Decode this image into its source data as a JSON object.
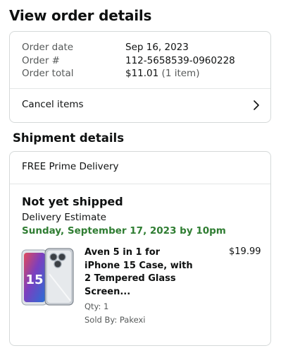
{
  "page": {
    "title": "View order details"
  },
  "order_summary": {
    "date_label": "Order date",
    "date_value": "Sep 16, 2023",
    "number_label": "Order #",
    "number_value": "112-5658539-0960228",
    "total_label": "Order total",
    "total_value": "$11.01",
    "total_items": "(1 item)",
    "cancel_label": "Cancel items"
  },
  "shipment": {
    "section_title": "Shipment details",
    "delivery_type": "FREE Prime Delivery",
    "status": "Not yet shipped",
    "estimate_label": "Delivery Estimate",
    "estimate_date": "Sunday, September 17, 2023 by 10pm",
    "item": {
      "title": "Aven 5 in 1 for iPhone 15 Case, with 2 Tempered Glass Screen...",
      "price": "$19.99",
      "qty": "Qty: 1",
      "seller": "Sold By: Pakexi",
      "thumb_badge": "15"
    }
  },
  "colors": {
    "estimate_green": "#2f7d32",
    "border": "#d5d9d9",
    "text": "#0f1111",
    "muted": "#565959"
  },
  "icons": {
    "cancel_chevron": "chevron-right-icon",
    "product_image": "phone-case-image"
  }
}
